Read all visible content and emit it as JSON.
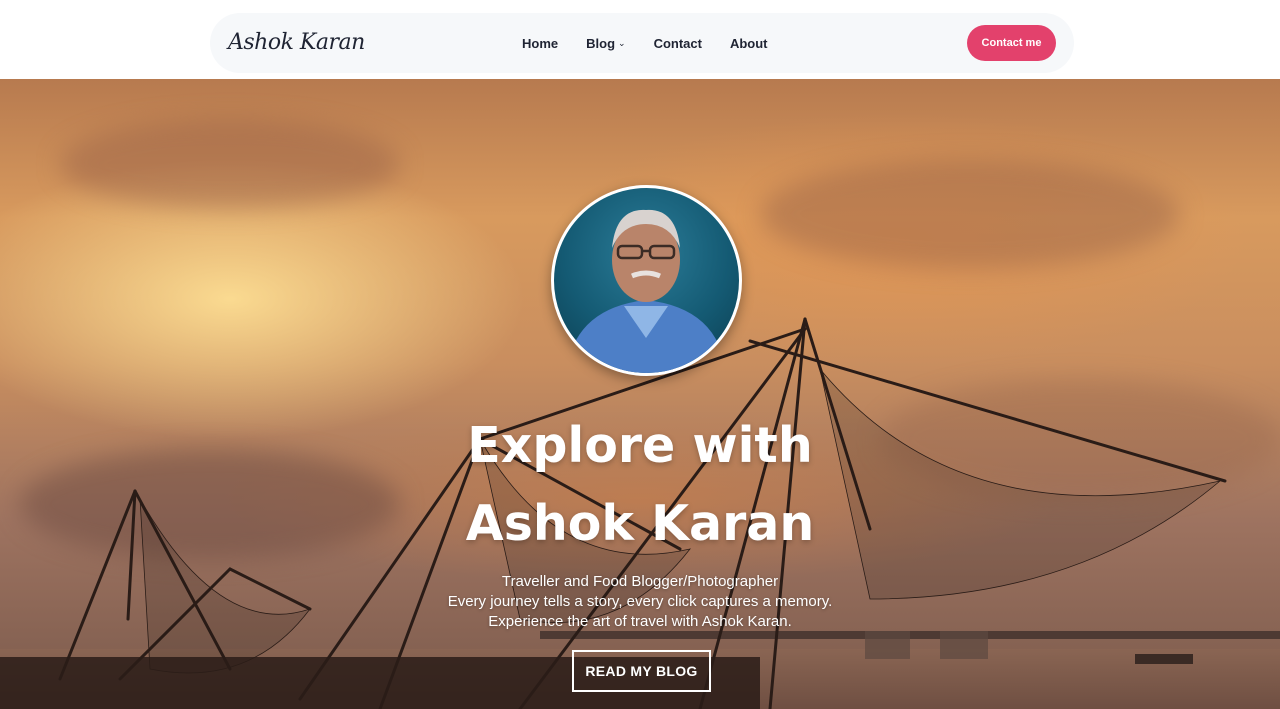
{
  "header": {
    "logo_text": "Ashok Karan",
    "nav": [
      {
        "label": "Home"
      },
      {
        "label": "Blog",
        "has_dropdown": true
      },
      {
        "label": "Contact"
      },
      {
        "label": "About"
      }
    ],
    "cta_label": "Contact me"
  },
  "hero": {
    "title_line1": "Explore with",
    "title_line2": "Ashok Karan",
    "tagline": [
      "Traveller and Food Blogger/Photographer",
      "Every journey tells a story, every click captures a memory.",
      "Experience the art of travel with Ashok Karan."
    ],
    "button_label": "READ MY BLOG"
  },
  "colors": {
    "accent": "#e3416c",
    "nav_bg": "#f6f8fa",
    "text_dark": "#1f2433"
  },
  "icons": {
    "dropdown": "chevron-down-icon"
  }
}
